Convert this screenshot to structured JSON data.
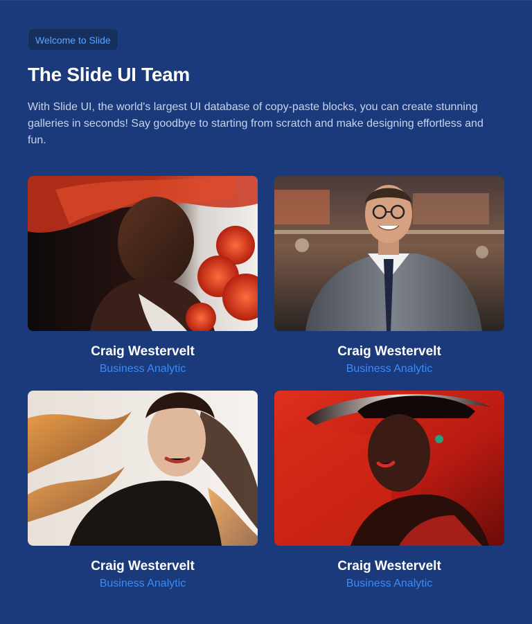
{
  "header": {
    "badge": "Welcome to Slide",
    "title": "The Slide UI Team",
    "description": "With Slide UI, the world's largest UI database of copy-paste blocks, you can create stunning galleries in seconds! Say goodbye to starting from scratch and make designing effortless and fun."
  },
  "team": [
    {
      "name": "Craig Westervelt",
      "role": "Business Analytic",
      "photo": "woman-red-hat-roses-photo"
    },
    {
      "name": "Craig Westervelt",
      "role": "Business Analytic",
      "photo": "smiling-man-glasses-suit-photo"
    },
    {
      "name": "Craig Westervelt",
      "role": "Business Analytic",
      "photo": "woman-flowing-orange-hair-photo"
    },
    {
      "name": "Craig Westervelt",
      "role": "Business Analytic",
      "photo": "woman-red-wide-hat-photo"
    }
  ],
  "colors": {
    "background": "#1a3a7b",
    "accent": "#3d8bf5",
    "badge_bg": "#15305f"
  }
}
